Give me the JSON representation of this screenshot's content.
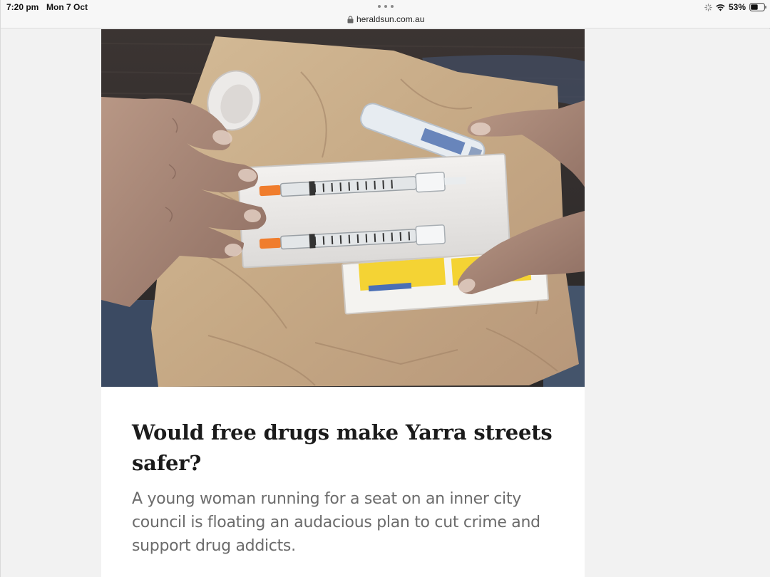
{
  "status_bar": {
    "time": "7:20 pm",
    "date": "Mon 7 Oct",
    "url": "heraldsun.com.au",
    "battery_percent": "53%",
    "icons": [
      "activity-icon",
      "wifi-icon",
      "battery-icon",
      "lock-icon",
      "more-dots-icon"
    ]
  },
  "article": {
    "headline": "Would free drugs make Yarra streets safer?",
    "standfirst": "A young woman running for a seat on an inner city council is floating an audacious plan to cut crime and support drug addicts."
  },
  "colors": {
    "page_background": "#f2f2f2",
    "card_background": "#ffffff",
    "headline": "#1b1b1b",
    "standfirst": "#6b6b6b"
  }
}
